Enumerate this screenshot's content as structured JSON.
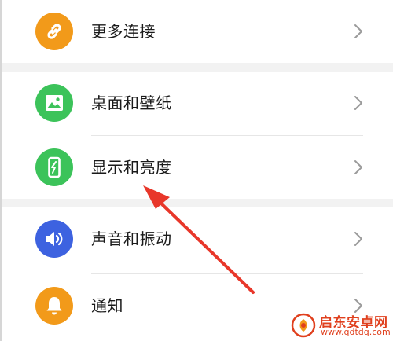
{
  "settings": {
    "items": [
      {
        "label": "更多连接",
        "icon": "link-icon",
        "color": "#f29a1a"
      },
      {
        "label": "桌面和壁纸",
        "icon": "image-icon",
        "color": "#3cc35a"
      },
      {
        "label": "显示和亮度",
        "icon": "phone-display-icon",
        "color": "#3cc35a"
      },
      {
        "label": "声音和振动",
        "icon": "speaker-icon",
        "color": "#3d62e0"
      },
      {
        "label": "通知",
        "icon": "bell-icon",
        "color": "#f29a1a"
      }
    ]
  },
  "annotation": {
    "arrow_color": "#e8372a"
  },
  "watermark": {
    "name": "启东安卓网",
    "url": "www.qdtdq.com",
    "color": "#e0401e"
  }
}
